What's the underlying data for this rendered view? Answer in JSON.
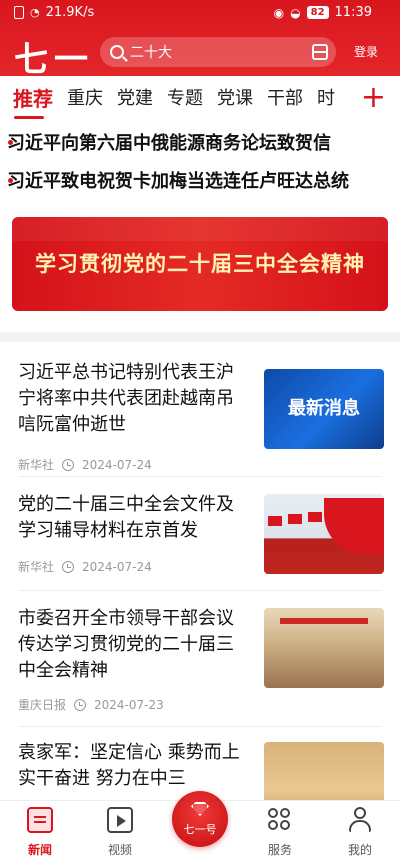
{
  "status_bar": {
    "speed": "21.9K/s",
    "battery": "82",
    "time": "11:39"
  },
  "app_bar": {
    "logo": "七一",
    "search_placeholder": "二十大",
    "login": "登录"
  },
  "tabs": {
    "items": [
      "推荐",
      "重庆",
      "党建",
      "专题",
      "党课",
      "干部",
      "时"
    ],
    "active": "推荐"
  },
  "ticker": [
    "习近平向第六届中俄能源商务论坛致贺信",
    "习近平致电祝贺卡加梅当选连任卢旺达总统"
  ],
  "banner": {
    "text": "学习贯彻党的二十届三中全会精神"
  },
  "news": [
    {
      "title": "习近平总书记特别代表王沪宁将率中共代表团赴越南吊唁阮富仲逝世",
      "source": "新华社",
      "date": "2024-07-24",
      "thumb_text": "最新消息"
    },
    {
      "title": "党的二十届三中全会文件及学习辅导材料在京首发",
      "source": "新华社",
      "date": "2024-07-24"
    },
    {
      "title": "市委召开全市领导干部会议 传达学习贯彻党的二十届三中全会精神",
      "source": "重庆日报",
      "date": "2024-07-23"
    },
    {
      "title": "袁家军：坚定信心 乘势而上 实干奋进 努力在中三"
    }
  ],
  "bottom_nav": [
    {
      "label": "新闻",
      "icon": "news-icon"
    },
    {
      "label": "视频",
      "icon": "video-icon"
    },
    {
      "label": "七一号",
      "icon": "gem-icon"
    },
    {
      "label": "服务",
      "icon": "service-icon"
    },
    {
      "label": "我的",
      "icon": "user-icon"
    }
  ],
  "colors": {
    "brand_red": "#d9161e",
    "text_dark": "#111111",
    "meta_gray": "#999999"
  }
}
